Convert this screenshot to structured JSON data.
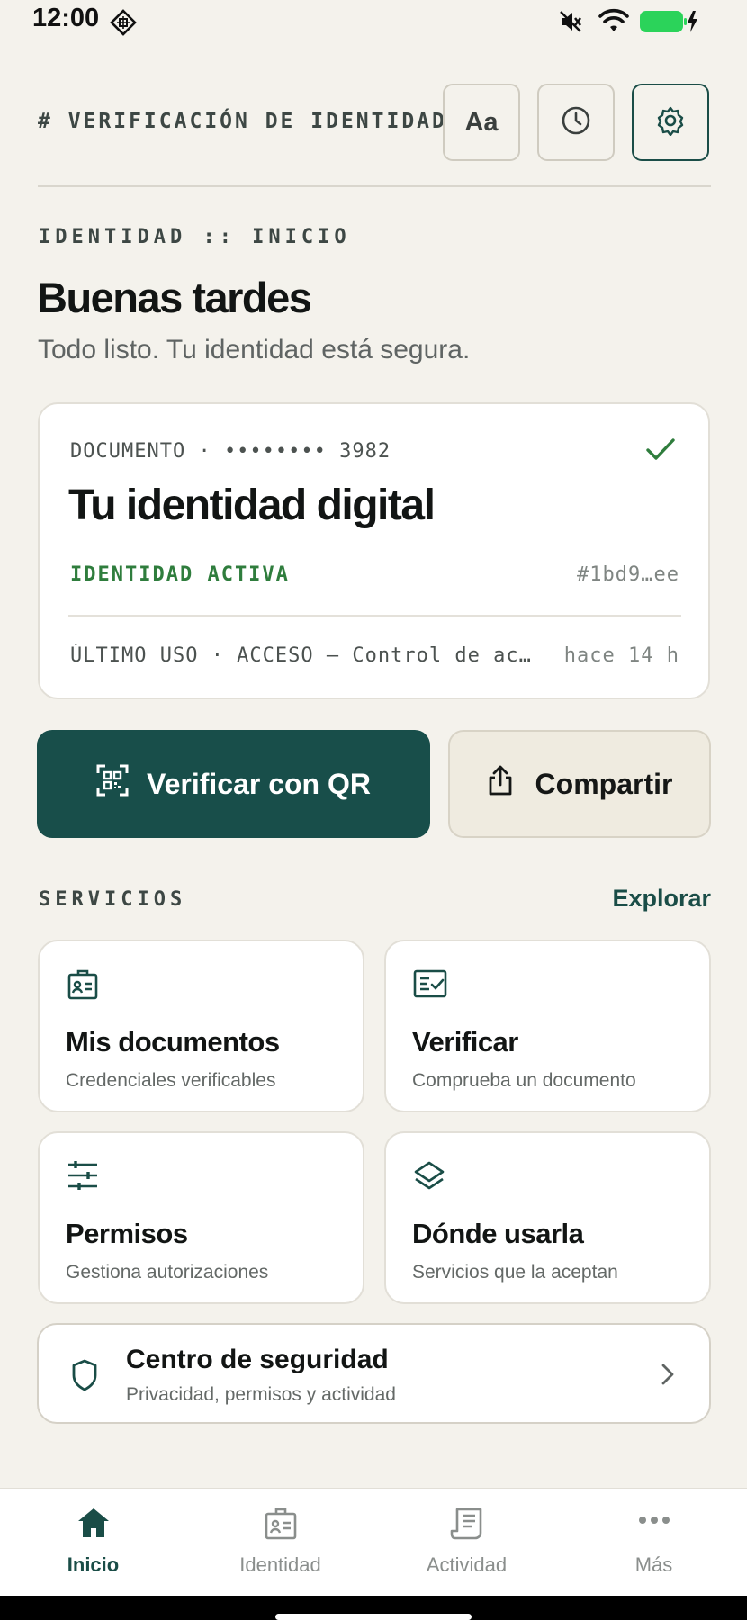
{
  "status_bar": {
    "time": "12:00",
    "battery_color": "#2bd35a"
  },
  "header": {
    "title": "# VERIFICACIÓN DE IDENTIDAD",
    "text_size_label": "Aa"
  },
  "breadcrumb": "IDENTIDAD :: INICIO",
  "greeting": "Buenas tardes",
  "subtitle": "Todo listo. Tu identidad está segura.",
  "identity_card": {
    "document_line": "DOCUMENTO · •••••••• 3982",
    "title": "Tu identidad digital",
    "status": "IDENTIDAD ACTIVA",
    "hash": "#1bd9…ee",
    "last_use": "ÚLTIMO USO · ACCESO — Control de ac…",
    "last_use_time": "hace 14 h"
  },
  "actions": {
    "verify_qr_label": "Verificar con QR",
    "share_label": "Compartir"
  },
  "services": {
    "heading": "SERVICIOS",
    "explore_label": "Explorar",
    "items": [
      {
        "title": "Mis documentos",
        "desc": "Credenciales verificables",
        "icon": "id-badge-icon"
      },
      {
        "title": "Verificar",
        "desc": "Comprueba un documento",
        "icon": "verify-document-icon"
      },
      {
        "title": "Permisos",
        "desc": "Gestiona autorizaciones",
        "icon": "sliders-icon"
      },
      {
        "title": "Dónde usarla",
        "desc": "Servicios que la aceptan",
        "icon": "layers-icon"
      }
    ]
  },
  "security_center": {
    "title": "Centro de seguridad",
    "desc": "Privacidad, permisos y actividad"
  },
  "bottom_nav": [
    {
      "label": "Inicio",
      "icon": "home-icon",
      "active": true
    },
    {
      "label": "Identidad",
      "icon": "id-card-icon",
      "active": false
    },
    {
      "label": "Actividad",
      "icon": "receipt-icon",
      "active": false
    },
    {
      "label": "Más",
      "icon": "more-icon",
      "active": false
    }
  ],
  "colors": {
    "accent": "#184e4a",
    "active_green": "#2f7d3d",
    "background": "#f4f2ec"
  }
}
